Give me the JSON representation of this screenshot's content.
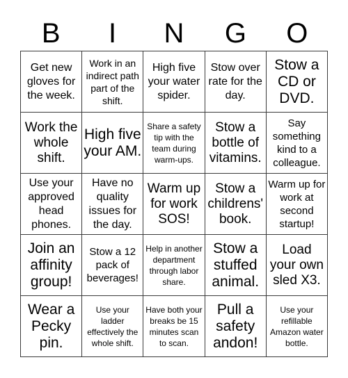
{
  "header": {
    "letters": [
      "B",
      "I",
      "N",
      "G",
      "O"
    ]
  },
  "board": {
    "rows": [
      [
        {
          "text": "Get new gloves for the week.",
          "size": "s-m"
        },
        {
          "text": "Work in an indirect path part of the shift.",
          "size": "s-s"
        },
        {
          "text": "High five your water spider.",
          "size": "s-m"
        },
        {
          "text": "Stow over rate for the day.",
          "size": "s-m"
        },
        {
          "text": "Stow a CD or DVD.",
          "size": "s-xl"
        }
      ],
      [
        {
          "text": "Work the whole shift.",
          "size": "s-l"
        },
        {
          "text": "High five your AM.",
          "size": "s-xl"
        },
        {
          "text": "Share a safety tip with the team during warm-ups.",
          "size": "s-xs"
        },
        {
          "text": "Stow a bottle of vitamins.",
          "size": "s-l"
        },
        {
          "text": "Say something kind to a colleague.",
          "size": "s-ms"
        }
      ],
      [
        {
          "text": "Use your approved head phones.",
          "size": "s-m"
        },
        {
          "text": "Have no quality issues for the day.",
          "size": "s-m"
        },
        {
          "text": "Warm up for work SOS!",
          "size": "s-l"
        },
        {
          "text": "Stow a childrens' book.",
          "size": "s-l"
        },
        {
          "text": "Warm up for work at second startup!",
          "size": "s-ms"
        }
      ],
      [
        {
          "text": "Join an affinity group!",
          "size": "s-xl"
        },
        {
          "text": "Stow a 12 pack of beverages!",
          "size": "s-ms"
        },
        {
          "text": "Help in another department through labor share.",
          "size": "s-xs"
        },
        {
          "text": "Stow a stuffed animal.",
          "size": "s-xl"
        },
        {
          "text": "Load your own sled X3.",
          "size": "s-l"
        }
      ],
      [
        {
          "text": "Wear a Pecky pin.",
          "size": "s-xl"
        },
        {
          "text": "Use your ladder effectively the whole shift.",
          "size": "s-xs"
        },
        {
          "text": "Have both your breaks be 15 minutes scan to scan.",
          "size": "s-xs"
        },
        {
          "text": "Pull a safety andon!",
          "size": "s-xl"
        },
        {
          "text": "Use your refillable Amazon water bottle.",
          "size": "s-xs"
        }
      ]
    ]
  }
}
